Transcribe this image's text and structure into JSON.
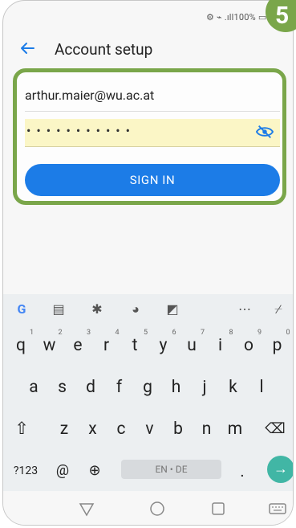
{
  "status": {
    "text": "⚙ ⌁ .ıll100% ▭ 3:4"
  },
  "badge": "5",
  "appbar": {
    "title": "Account setup"
  },
  "form": {
    "email": "arthur.maier@wu.ac.at",
    "password_mask": "• • • • • • • • • • •",
    "sign_in_label": "SIGN IN"
  },
  "keyboard": {
    "row1": [
      {
        "k": "q",
        "n": "1"
      },
      {
        "k": "w",
        "n": "2"
      },
      {
        "k": "e",
        "n": "3"
      },
      {
        "k": "r",
        "n": "4"
      },
      {
        "k": "t",
        "n": "5"
      },
      {
        "k": "y",
        "n": "6"
      },
      {
        "k": "u",
        "n": "7"
      },
      {
        "k": "i",
        "n": "8"
      },
      {
        "k": "o",
        "n": "9"
      },
      {
        "k": "p",
        "n": "0"
      }
    ],
    "row2": [
      "a",
      "s",
      "d",
      "f",
      "g",
      "h",
      "j",
      "k",
      "l"
    ],
    "row3": [
      "z",
      "x",
      "c",
      "v",
      "b",
      "n",
      "m"
    ],
    "sym_label": "?123",
    "at_label": "@",
    "space_label": "EN • DE"
  }
}
